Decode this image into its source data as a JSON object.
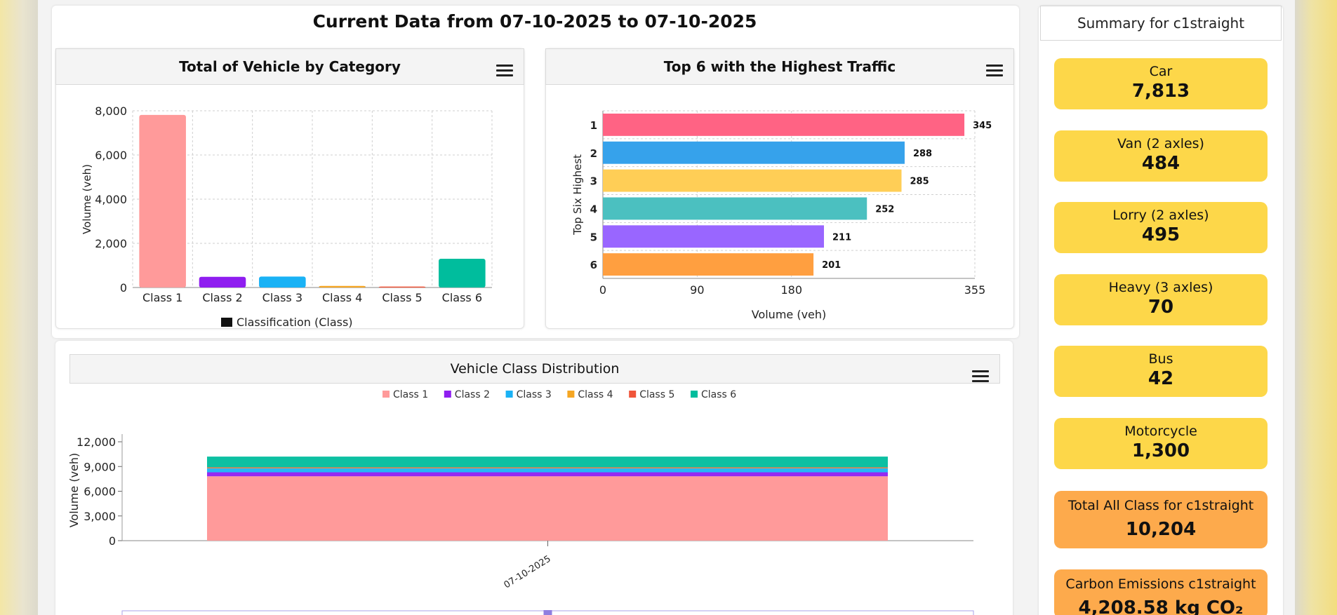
{
  "page": {
    "title": "Current Data from 07-10-2025 to 07-10-2025"
  },
  "colors": {
    "card_yellow": "#fdd749",
    "card_orange": "#fdaa4c"
  },
  "icons": {
    "menu": "hamburger-menu-icon"
  },
  "chart_data": [
    {
      "type": "bar",
      "title": "Total of Vehicle by Category",
      "categories": [
        "Class 1",
        "Class 2",
        "Class 3",
        "Class 4",
        "Class 5",
        "Class 6"
      ],
      "values": [
        7813,
        484,
        495,
        70,
        42,
        1300
      ],
      "colors": [
        "#ff9a9a",
        "#8f1ef0",
        "#1ab2f5",
        "#f5a623",
        "#f0553a",
        "#00bd9d"
      ],
      "ylabel": "Volume (veh)",
      "legend": "Classification (Class)",
      "ylim": [
        0,
        8000
      ],
      "yticks": [
        "0",
        "2,000",
        "4,000",
        "6,000",
        "8,000"
      ],
      "grid": true
    },
    {
      "type": "bar",
      "orientation": "horizontal",
      "title": "Top 6 with the Highest Traffic",
      "categories": [
        "1",
        "2",
        "3",
        "4",
        "5",
        "6"
      ],
      "values": [
        345,
        288,
        285,
        252,
        211,
        201
      ],
      "colors": [
        "#ff6384",
        "#36a2eb",
        "#ffce56",
        "#4bc0c0",
        "#9966ff",
        "#ff9f40"
      ],
      "xlabel": "Volume (veh)",
      "ylabel": "Top Six Highest",
      "xlim": [
        0,
        355
      ],
      "xticks": [
        "0",
        "90",
        "180",
        "355"
      ],
      "grid": true
    },
    {
      "type": "area",
      "stacked": true,
      "title": "Vehicle Class Distribution",
      "x": [
        "07-10-2025"
      ],
      "ylabel": "Volume (veh)",
      "ylim": [
        0,
        12000
      ],
      "yticks": [
        "0",
        "3,000",
        "6,000",
        "9,000",
        "12,000"
      ],
      "legend_position": "top",
      "series": [
        {
          "name": "Class 1",
          "values": [
            7813
          ],
          "color": "#ff9a9a"
        },
        {
          "name": "Class 2",
          "values": [
            484
          ],
          "color": "#8f1ef0"
        },
        {
          "name": "Class 3",
          "values": [
            495
          ],
          "color": "#1ab2f5"
        },
        {
          "name": "Class 4",
          "values": [
            70
          ],
          "color": "#f5a623"
        },
        {
          "name": "Class 5",
          "values": [
            42
          ],
          "color": "#f0553a"
        },
        {
          "name": "Class 6",
          "values": [
            1300
          ],
          "color": "#00bd9d"
        }
      ]
    }
  ],
  "summary": {
    "title": "Summary for c1straight",
    "items": [
      {
        "label": "Car",
        "value": "7,813"
      },
      {
        "label": "Van (2 axles)",
        "value": "484"
      },
      {
        "label": "Lorry (2 axles)",
        "value": "495"
      },
      {
        "label": "Heavy (3 axles)",
        "value": "70"
      },
      {
        "label": "Bus",
        "value": "42"
      },
      {
        "label": "Motorcycle",
        "value": "1,300"
      }
    ],
    "total": {
      "label": "Total All Class for c1straight",
      "value": "10,204"
    },
    "carbon": {
      "label": "Carbon Emissions c1straight",
      "value": "4,208.58 kg CO₂"
    }
  }
}
